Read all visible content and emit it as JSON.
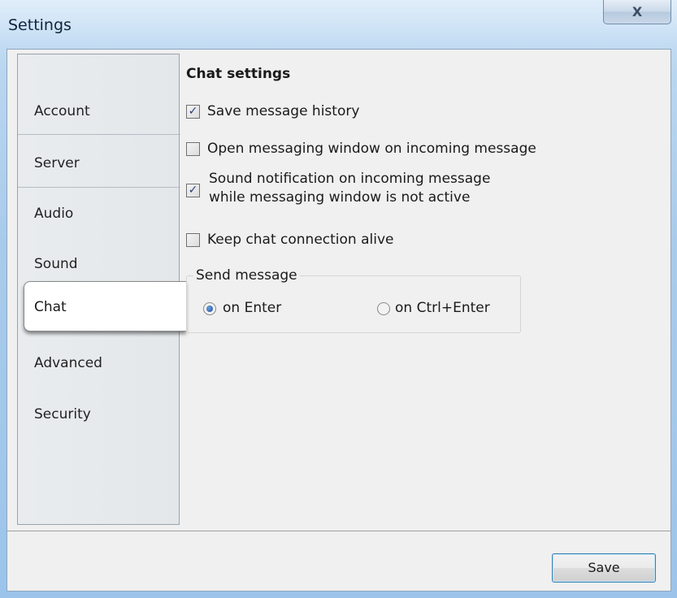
{
  "window": {
    "title": "Settings",
    "close_glyph": "X"
  },
  "nav": {
    "items": [
      {
        "label": "Account"
      },
      {
        "label": "Server"
      },
      {
        "label": "Audio"
      },
      {
        "label": "Sound"
      },
      {
        "label": "Chat",
        "selected": true
      },
      {
        "label": "Advanced"
      },
      {
        "label": "Security"
      }
    ]
  },
  "chat": {
    "heading": "Chat settings",
    "options": [
      {
        "label": "Save message history",
        "checked": true
      },
      {
        "label": "Open messaging window on incoming message",
        "checked": false
      },
      {
        "label_line1": "Sound notification on incoming message",
        "label_line2": "while messaging window is not active",
        "checked": true
      },
      {
        "label": "Keep chat connection alive",
        "checked": false
      }
    ],
    "send_message": {
      "title": "Send message",
      "on_enter": {
        "label": "on Enter",
        "selected": true
      },
      "on_ctrl_enter": {
        "label": "on Ctrl+Enter",
        "selected": false
      }
    }
  },
  "footer": {
    "save_label": "Save"
  },
  "icons": {
    "check": "✓",
    "close": "close-icon"
  }
}
